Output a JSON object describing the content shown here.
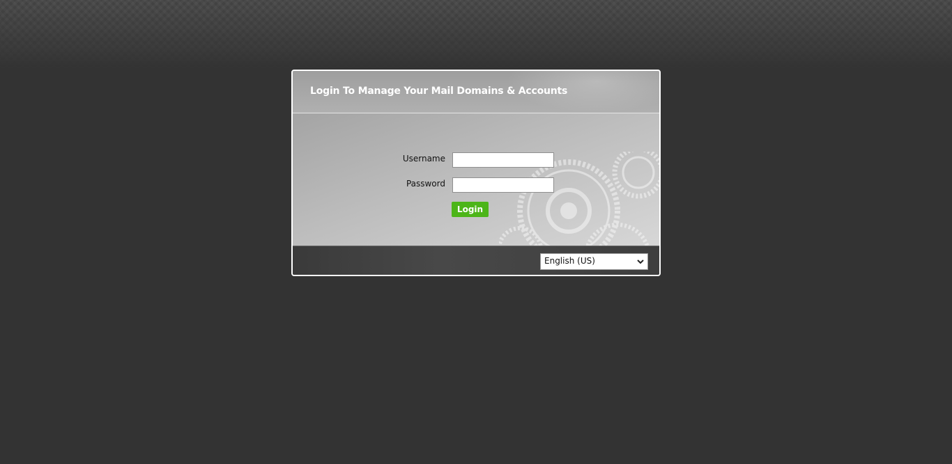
{
  "login": {
    "title": "Login To Manage Your Mail Domains & Accounts",
    "username_label": "Username",
    "username_value": "",
    "password_label": "Password",
    "password_value": "",
    "submit_label": "Login"
  },
  "footer": {
    "language_selected": "English (US)"
  },
  "colors": {
    "background": "#333333",
    "login_button": "#4cb519",
    "panel_border": "#ffffff"
  },
  "icons": {
    "decoration": "gears-icon",
    "select_arrow": "chevron-down-icon"
  }
}
